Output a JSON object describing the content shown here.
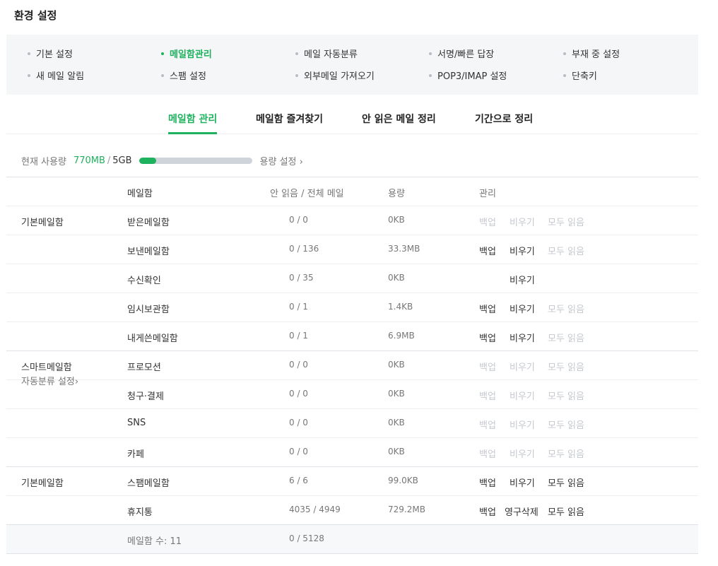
{
  "page_title": "환경 설정",
  "menu": {
    "items": [
      {
        "label": "기본 설정",
        "active": false
      },
      {
        "label": "메일함관리",
        "active": true
      },
      {
        "label": "메일 자동분류",
        "active": false
      },
      {
        "label": "서명/빠른 답장",
        "active": false
      },
      {
        "label": "부재 중 설정",
        "active": false
      },
      {
        "label": "새 메일 알림",
        "active": false
      },
      {
        "label": "스팸 설정",
        "active": false
      },
      {
        "label": "외부메일 가져오기",
        "active": false
      },
      {
        "label": "POP3/IMAP 설정",
        "active": false
      },
      {
        "label": "단축키",
        "active": false
      }
    ]
  },
  "tabs": [
    {
      "label": "메일함 관리",
      "active": true
    },
    {
      "label": "메일함 즐겨찾기",
      "active": false
    },
    {
      "label": "안 읽은 메일 정리",
      "active": false
    },
    {
      "label": "기간으로 정리",
      "active": false
    }
  ],
  "usage": {
    "label": "현재 사용량",
    "used": "770MB",
    "separator": "/",
    "total": "5GB",
    "fill_fraction": 0.15,
    "settings_link": "용량 설정 ›"
  },
  "table": {
    "headers": {
      "mailbox": "메일함",
      "count": "안 읽음 / 전체 메일",
      "size": "용량",
      "manage": "관리"
    },
    "groups": [
      {
        "name": "기본메일함",
        "sub": "",
        "rows": [
          {
            "name": "받은메일함",
            "count": "0 / 0",
            "size": "0KB",
            "backup": "백업",
            "backup_enabled": false,
            "empty": "비우기",
            "empty_enabled": false,
            "readall": "모두 읽음",
            "readall_enabled": false
          },
          {
            "name": "보낸메일함",
            "count": "0 / 136",
            "size": "33.3MB",
            "backup": "백업",
            "backup_enabled": true,
            "empty": "비우기",
            "empty_enabled": true,
            "readall": "모두 읽음",
            "readall_enabled": false
          },
          {
            "name": "수신확인",
            "count": "0 / 35",
            "size": "0KB",
            "backup": "",
            "backup_enabled": false,
            "empty": "비우기",
            "empty_enabled": true,
            "readall": "",
            "readall_enabled": false
          },
          {
            "name": "임시보관함",
            "count": "0 / 1",
            "size": "1.4KB",
            "backup": "백업",
            "backup_enabled": true,
            "empty": "비우기",
            "empty_enabled": true,
            "readall": "모두 읽음",
            "readall_enabled": false
          },
          {
            "name": "내게쓴메일함",
            "count": "0 / 1",
            "size": "6.9MB",
            "backup": "백업",
            "backup_enabled": true,
            "empty": "비우기",
            "empty_enabled": true,
            "readall": "모두 읽음",
            "readall_enabled": false
          }
        ]
      },
      {
        "name": "스마트메일함",
        "sub": "자동분류 설정›",
        "rows": [
          {
            "name": "프로모션",
            "count": "0 / 0",
            "size": "0KB",
            "backup": "백업",
            "backup_enabled": false,
            "empty": "비우기",
            "empty_enabled": false,
            "readall": "모두 읽음",
            "readall_enabled": false
          },
          {
            "name": "청구·결제",
            "count": "0 / 0",
            "size": "0KB",
            "backup": "백업",
            "backup_enabled": false,
            "empty": "비우기",
            "empty_enabled": false,
            "readall": "모두 읽음",
            "readall_enabled": false
          },
          {
            "name": "SNS",
            "count": "0 / 0",
            "size": "0KB",
            "backup": "백업",
            "backup_enabled": false,
            "empty": "비우기",
            "empty_enabled": false,
            "readall": "모두 읽음",
            "readall_enabled": false
          },
          {
            "name": "카페",
            "count": "0 / 0",
            "size": "0KB",
            "backup": "백업",
            "backup_enabled": false,
            "empty": "비우기",
            "empty_enabled": false,
            "readall": "모두 읽음",
            "readall_enabled": false
          }
        ]
      },
      {
        "name": "기본메일함",
        "sub": "",
        "rows": [
          {
            "name": "스팸메일함",
            "count": "6 / 6",
            "size": "99.0KB",
            "backup": "백업",
            "backup_enabled": true,
            "empty": "비우기",
            "empty_enabled": true,
            "readall": "모두 읽음",
            "readall_enabled": true
          },
          {
            "name": "휴지통",
            "count": "4035 / 4949",
            "size": "729.2MB",
            "backup": "백업",
            "backup_enabled": true,
            "empty": "영구삭제",
            "empty_enabled": true,
            "readall": "모두 읽음",
            "readall_enabled": true
          }
        ]
      }
    ],
    "footer": {
      "count_label": "메일함 수: 11",
      "total": "0 / 5128"
    }
  },
  "colors": {
    "accent": "#1fb25e",
    "disabled": "#c5c9cf",
    "menu_bg": "#f5f6f8"
  }
}
